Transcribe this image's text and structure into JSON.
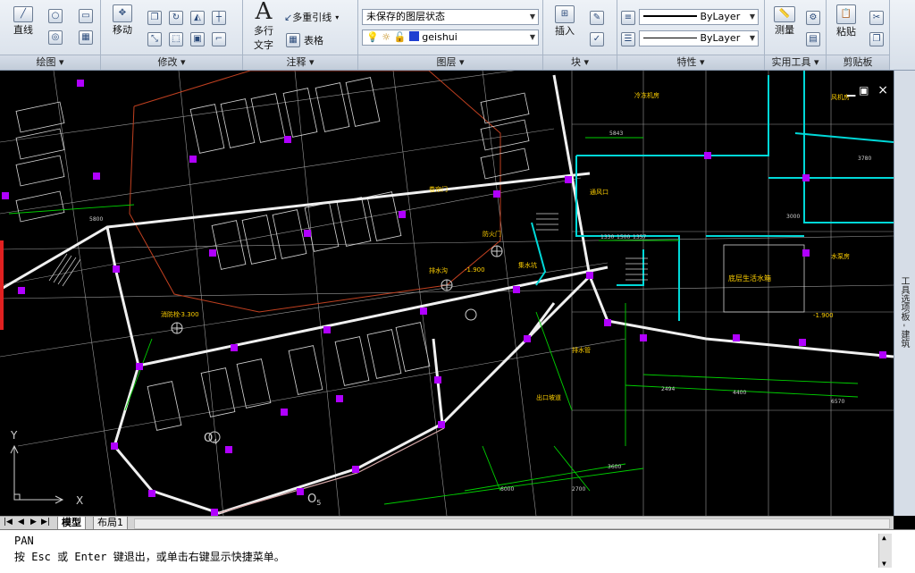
{
  "ribbon": {
    "draw": {
      "title": "绘图",
      "line_label": "直线"
    },
    "modify": {
      "title": "修改",
      "move_label": "移动"
    },
    "annotation": {
      "title": "注释",
      "mtext_label": "多行",
      "mtext_label2": "文字",
      "multileader_label": "多重引线",
      "table_label": "表格"
    },
    "layers": {
      "title": "图层",
      "layer_state": "未保存的图层状态",
      "current_layer": "geishui",
      "layer_color": "#1f3fd1"
    },
    "block": {
      "title": "块",
      "insert_label": "插入"
    },
    "properties": {
      "title": "特性",
      "color": "ByLayer",
      "linetype": "ByLayer"
    },
    "utilities": {
      "title": "实用工具",
      "measure_label": "测量"
    },
    "clipboard": {
      "title": "剪贴板",
      "paste_label": "粘贴"
    }
  },
  "drawing": {
    "ucs_x": "X",
    "ucs_y": "Y",
    "close": "×",
    "label_o4": "O",
    "label_o4_sub": "4",
    "label_o5": "O",
    "label_o5_sub": "5",
    "room_label": "底层生活水箱"
  },
  "side_palette": {
    "title": "工具选项板 - 建筑"
  },
  "layout_tabs": {
    "model": "模型",
    "layout1": "布局1"
  },
  "command": {
    "line1": "PAN",
    "line2": "按 Esc 或 Enter 键退出，或单击右键显示快捷菜单。"
  },
  "colors": {
    "grip": "#b000ff",
    "wall": "#f0f0f0",
    "cyan": "#00d8d8",
    "green": "#00d000",
    "yellow": "#ffd000",
    "red_frame": "#c04020"
  }
}
